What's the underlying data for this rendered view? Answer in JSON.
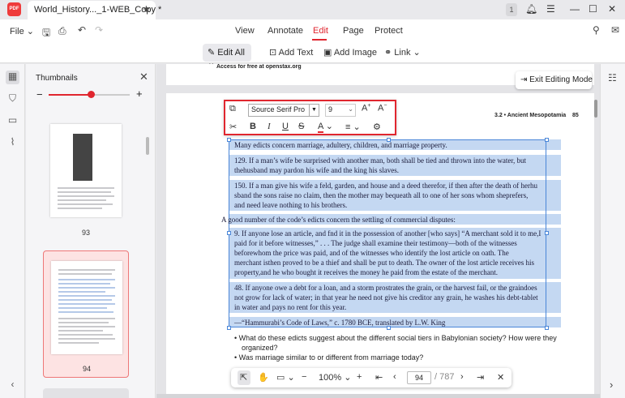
{
  "app": {
    "logo_text": "PDF"
  },
  "tab": {
    "title": "World_History..._1-WEB_Copy *",
    "notification_count": "1"
  },
  "menu": {
    "file": "File",
    "items": [
      "View",
      "Annotate",
      "Edit",
      "Page",
      "Protect"
    ],
    "active": "Edit"
  },
  "edit_toolbar": {
    "edit_all": "Edit All",
    "add_text": "Add Text",
    "add_image": "Add Image",
    "link": "Link"
  },
  "thumbnails": {
    "title": "Thumbnails",
    "pages": [
      "93",
      "94"
    ],
    "selected": "94",
    "zoom_fraction": 0.52
  },
  "document": {
    "top_snippet": "Access for free at openstax.org",
    "running_header": "3.2 • Ancient Mesopotamia",
    "page_number": "85",
    "lines": [
      "Many edicts concern marriage, adultery, children, and marriage property.",
      "129. If a man’s wife be surprised with another man, both shall be tied and thrown into the water, but",
      "thehusband may pardon his wife and the king his slaves.",
      "150. If a man give his wife a feld, garden, and house and a deed therefor, if then after the death of herhu",
      "sband the sons raise no claim, then the mother may bequeath all to one of her sons whom sheprefers,",
      "and need leave nothing to his brothers.",
      "A good number of the code’s edicts concern the settling of commercial disputes:",
      "9. If anyone lose an article, and fnd it in the possession of another [who says] “A merchant sold it to me,I",
      " paid for it before witnesses,” . . . The judge shall examine their testimony—both of the witnesses",
      "beforewhom the price was paid, and of the witnesses who identify the lost article on oath. The",
      "merchant isthen proved to be a thief and shall be put to death. The owner of the lost article receives his",
      "property,and he who bought it receives the money he paid from the estate of the merchant.",
      "48. If anyone owe a debt for a loan, and a storm prostrates the grain, or the harvest fail, or the graindoes",
      "not grow for lack of water; in that year he need not give his creditor any grain, he washes his debt-tablet",
      "in water and pays no rent for this year.",
      "—“Hammurabi’s Code of Laws,” c. 1780 BCE, translated by L.W. King"
    ],
    "bullets": [
      "What do these edicts suggest about the different social tiers in Babylonian society? How were they",
      "organized?",
      "Was marriage similar to or different from marriage today?"
    ]
  },
  "format_toolbar": {
    "font": "Source Serif Pro",
    "size": "9"
  },
  "exit_button": "Exit Editing Mode",
  "navigation": {
    "zoom": "100%",
    "current_page": "94",
    "total_pages": "/ 787"
  }
}
